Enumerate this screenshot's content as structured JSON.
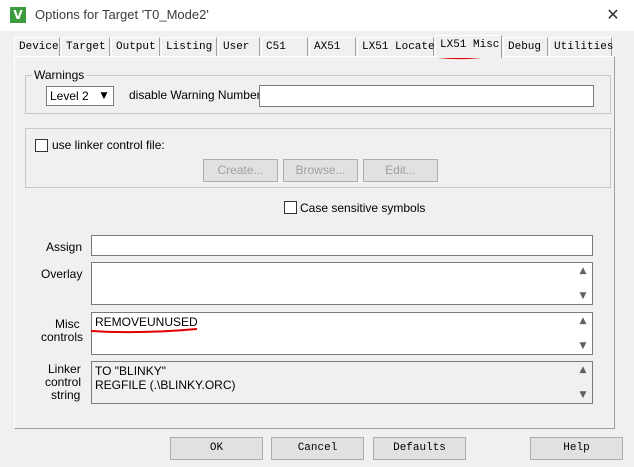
{
  "window": {
    "title": "Options for Target 'T0_Mode2'",
    "app_icon": "keil-uvision-icon",
    "app_icon_glyph": "V",
    "close_glyph": "✕"
  },
  "tabs": [
    {
      "label": "Device"
    },
    {
      "label": "Target"
    },
    {
      "label": "Output"
    },
    {
      "label": "Listing"
    },
    {
      "label": "User"
    },
    {
      "label": "C51"
    },
    {
      "label": "AX51"
    },
    {
      "label": "LX51 Locate"
    },
    {
      "label": "LX51 Misc",
      "active": true
    },
    {
      "label": "Debug"
    },
    {
      "label": "Utilities"
    }
  ],
  "warnings": {
    "legend": "Warnings",
    "level_value": "Level 2",
    "disable_label": "disable Warning Numbers:",
    "disable_value": ""
  },
  "linker_control": {
    "checkbox_label": "use linker control file:",
    "checked": false,
    "create_label": "Create...",
    "browse_label": "Browse...",
    "edit_label": "Edit..."
  },
  "case_sensitive": {
    "label": "Case sensitive symbols",
    "checked": false
  },
  "fields": {
    "assign_label": "Assign",
    "assign_value": "",
    "overlay_label": "Overlay",
    "overlay_value": "",
    "misc_label_line1": "Misc",
    "misc_label_line2": "controls",
    "misc_value": "REMOVEUNUSED",
    "linker_label_line1": "Linker",
    "linker_label_line2": "control",
    "linker_label_line3": "string",
    "linker_line1": "TO \"BLINKY\"",
    "linker_line2": "REGFILE (.\\BLINKY.ORC)"
  },
  "buttons": {
    "ok": "OK",
    "cancel": "Cancel",
    "defaults": "Defaults",
    "help": "Help"
  },
  "colors": {
    "annotation": "#e00000"
  },
  "icons": {
    "dropdown": "▼",
    "scroll_up": "▲",
    "scroll_down": "▼"
  }
}
